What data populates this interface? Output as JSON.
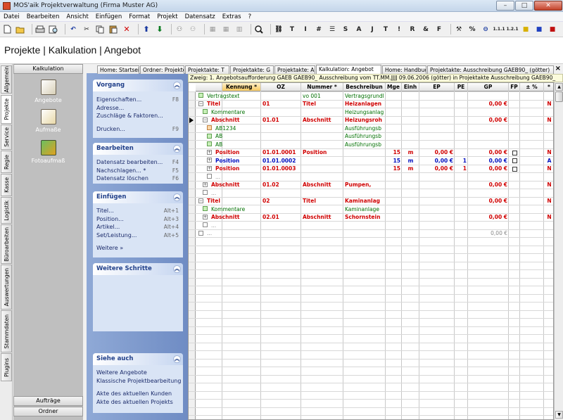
{
  "window": {
    "title": "MOS'aik Projektverwaltung (Firma Muster AG)"
  },
  "menu": [
    "Datei",
    "Bearbeiten",
    "Ansicht",
    "Einfügen",
    "Format",
    "Projekt",
    "Datensatz",
    "Extras",
    "?"
  ],
  "toolbar_text": [
    "T",
    "I",
    "#",
    "S",
    "A",
    "J",
    "T",
    "!",
    "R",
    "&",
    "F",
    "%"
  ],
  "page_title": "Projekte | Kalkulation | Angebot",
  "vertical_tabs": [
    "Allgemein",
    "Projekte",
    "Service",
    "Regie",
    "Kasse",
    "Logistik",
    "Büroarbeiten",
    "Auswertungen",
    "Stammdaten",
    "Plugins"
  ],
  "left_panel": {
    "header": "Kalkulation",
    "items": [
      "Angebote",
      "Aufmaße",
      "Fotoaufmaß"
    ],
    "footer": [
      "Aufträge",
      "Ordner"
    ]
  },
  "tasks": {
    "vorgang": {
      "title": "Vorgang",
      "items": [
        {
          "label": "Eigenschaften...",
          "shortcut": "F8"
        },
        {
          "label": "Adresse...",
          "shortcut": ""
        },
        {
          "label": "Zuschläge & Faktoren...",
          "shortcut": ""
        },
        {
          "label": "Drucken...",
          "shortcut": "F9"
        }
      ]
    },
    "bearbeiten": {
      "title": "Bearbeiten",
      "items": [
        {
          "label": "Datensatz bearbeiten...",
          "shortcut": "F4"
        },
        {
          "label": "Nachschlagen... *",
          "shortcut": "F5"
        },
        {
          "label": "Datensatz löschen",
          "shortcut": "F6"
        }
      ]
    },
    "einfuegen": {
      "title": "Einfügen",
      "items": [
        {
          "label": "Titel...",
          "shortcut": "Alt+1"
        },
        {
          "label": "Position...",
          "shortcut": "Alt+3"
        },
        {
          "label": "Artikel...",
          "shortcut": "Alt+4"
        },
        {
          "label": "Set/Leistung...",
          "shortcut": "Alt+5"
        },
        {
          "label": "Weitere »",
          "shortcut": ""
        }
      ]
    },
    "weitere": {
      "title": "Weitere Schritte",
      "items": [
        "Nummerieren...",
        "Kopieren »",
        "Workflow anzeigen »",
        "Plugins »"
      ]
    },
    "siehe": {
      "title": "Siehe auch",
      "items": [
        "Weitere Angebote",
        "Klassische Projektbearbeitung",
        "Akte des aktuellen Kunden",
        "Akte des aktuellen Projekts"
      ]
    }
  },
  "tabs": [
    "Home: Startseite",
    "Ordner: Projekte",
    "Projektakte: T",
    "Projektakte: G",
    "Projektakte: A",
    "Kalkulation: Angebot",
    "Home: Handbuch",
    "Projektakte: Ausschreibung GAEB90_ (götter)"
  ],
  "info_bar": "Zweig: 1. Angebotsaufforderung GAEB GAEB90_ Ausschreibung vom TT.MM.JJJJ 09.06.2006 (götter) in Projektakte Ausschreibung GAEB90_",
  "grid": {
    "columns": [
      "Kennung *",
      "OZ",
      "Nummer *",
      "Beschreibun",
      "Mge",
      "Einh",
      "EP",
      "PE",
      "GP",
      "FP",
      "± %",
      "*"
    ],
    "rows": [
      {
        "kennung": "Vertragstext",
        "oz": "",
        "nummer": "vo 001",
        "beschr": "Vertragsgrundl",
        "mge": "",
        "einh": "",
        "ep": "",
        "pe": "",
        "gp": "",
        "fp": "",
        "pct": "",
        "star": "",
        "style": "green"
      },
      {
        "kennung": "Titel",
        "oz": "01",
        "nummer": "Titel",
        "beschr": "Heizanlagen",
        "mge": "",
        "einh": "",
        "ep": "",
        "pe": "",
        "gp": "0,00 €",
        "fp": "",
        "pct": "",
        "star": "N",
        "style": "red"
      },
      {
        "kennung": "Kommentare",
        "oz": "",
        "nummer": "",
        "beschr": "Heizungsanlag",
        "mge": "",
        "einh": "",
        "ep": "",
        "pe": "",
        "gp": "",
        "fp": "",
        "pct": "",
        "star": "",
        "style": "green"
      },
      {
        "kennung": "Abschnitt",
        "oz": "01.01",
        "nummer": "Abschnitt",
        "beschr": "Heizungsroh",
        "mge": "",
        "einh": "",
        "ep": "",
        "pe": "",
        "gp": "0,00 €",
        "fp": "",
        "pct": "",
        "star": "N",
        "style": "red"
      },
      {
        "kennung": "AB1234",
        "oz": "",
        "nummer": "",
        "beschr": "Ausführungsb",
        "mge": "",
        "einh": "",
        "ep": "",
        "pe": "",
        "gp": "",
        "fp": "",
        "pct": "",
        "star": "",
        "style": "green"
      },
      {
        "kennung": "AB",
        "oz": "",
        "nummer": "",
        "beschr": "Ausführungsb",
        "mge": "",
        "einh": "",
        "ep": "",
        "pe": "",
        "gp": "",
        "fp": "",
        "pct": "",
        "star": "",
        "style": "green"
      },
      {
        "kennung": "AB",
        "oz": "",
        "nummer": "",
        "beschr": "Ausführungsb",
        "mge": "",
        "einh": "",
        "ep": "",
        "pe": "",
        "gp": "",
        "fp": "",
        "pct": "",
        "star": "",
        "style": "green"
      },
      {
        "kennung": "Position",
        "oz": "01.01.0001",
        "nummer": "Position",
        "beschr": "",
        "mge": "15",
        "einh": "m",
        "ep": "0,00 €",
        "pe": "",
        "gp": "0,00 €",
        "fp": "cb",
        "pct": "",
        "star": "N",
        "style": "red"
      },
      {
        "kennung": "Position",
        "oz": "01.01.0002",
        "nummer": "",
        "beschr": "",
        "mge": "15",
        "einh": "m",
        "ep": "0,00 €",
        "pe": "1",
        "gp": "0,00 €",
        "fp": "cb",
        "pct": "",
        "star": "A",
        "style": "blue"
      },
      {
        "kennung": "Position",
        "oz": "01.01.0003",
        "nummer": "",
        "beschr": "",
        "mge": "15",
        "einh": "m",
        "ep": "0,00 €",
        "pe": "1",
        "gp": "0,00 €",
        "fp": "cb",
        "pct": "",
        "star": "N",
        "style": "red"
      },
      {
        "kennung": "...",
        "oz": "",
        "nummer": "",
        "beschr": "",
        "mge": "",
        "einh": "",
        "ep": "",
        "pe": "",
        "gp": "",
        "fp": "",
        "pct": "",
        "star": "",
        "style": "gray"
      },
      {
        "kennung": "Abschnitt",
        "oz": "01.02",
        "nummer": "Abschnitt",
        "beschr": "Pumpen,",
        "mge": "",
        "einh": "",
        "ep": "",
        "pe": "",
        "gp": "0,00 €",
        "fp": "",
        "pct": "",
        "star": "N",
        "style": "red"
      },
      {
        "kennung": "...",
        "oz": "",
        "nummer": "",
        "beschr": "",
        "mge": "",
        "einh": "",
        "ep": "",
        "pe": "",
        "gp": "",
        "fp": "",
        "pct": "",
        "star": "",
        "style": "gray"
      },
      {
        "kennung": "Titel",
        "oz": "02",
        "nummer": "Titel",
        "beschr": "Kaminanlag",
        "mge": "",
        "einh": "",
        "ep": "",
        "pe": "",
        "gp": "0,00 €",
        "fp": "",
        "pct": "",
        "star": "N",
        "style": "red"
      },
      {
        "kennung": "Kommentare",
        "oz": "",
        "nummer": "",
        "beschr": "Kaminanlage",
        "mge": "",
        "einh": "",
        "ep": "",
        "pe": "",
        "gp": "",
        "fp": "",
        "pct": "",
        "star": "",
        "style": "green"
      },
      {
        "kennung": "Abschnitt",
        "oz": "02.01",
        "nummer": "Abschnitt",
        "beschr": "Schornstein",
        "mge": "",
        "einh": "",
        "ep": "",
        "pe": "",
        "gp": "0,00 €",
        "fp": "",
        "pct": "",
        "star": "N",
        "style": "red"
      },
      {
        "kennung": "...",
        "oz": "",
        "nummer": "",
        "beschr": "",
        "mge": "",
        "einh": "",
        "ep": "",
        "pe": "",
        "gp": "",
        "fp": "",
        "pct": "",
        "star": "",
        "style": "gray"
      },
      {
        "kennung": "...",
        "oz": "",
        "nummer": "",
        "beschr": "",
        "mge": "",
        "einh": "",
        "ep": "",
        "pe": "",
        "gp": "0,00 €",
        "fp": "",
        "pct": "",
        "star": "",
        "style": "gray"
      }
    ]
  }
}
